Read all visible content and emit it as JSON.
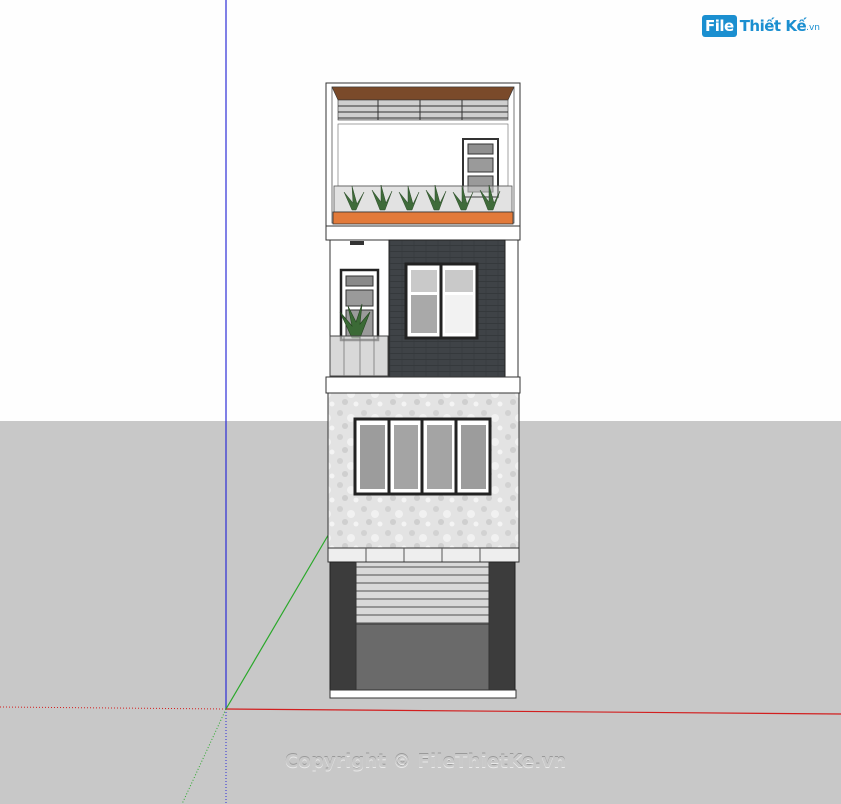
{
  "logo": {
    "box_text": "File",
    "main_text": "Thiết Kế",
    "suffix": ".vn"
  },
  "watermark": {
    "text": "Copyright © FileThietKe.vn"
  },
  "colors": {
    "sky": "#fefefe",
    "ground": "#c8c8c8",
    "axis_blue": "#2c2cd6",
    "axis_red": "#d21f1f",
    "axis_green": "#2aa82a",
    "brand": "#1b8fd0",
    "dark_wall": "#3e4247",
    "granite": "#e2e2e2",
    "orange_planter": "#e27a3a"
  }
}
